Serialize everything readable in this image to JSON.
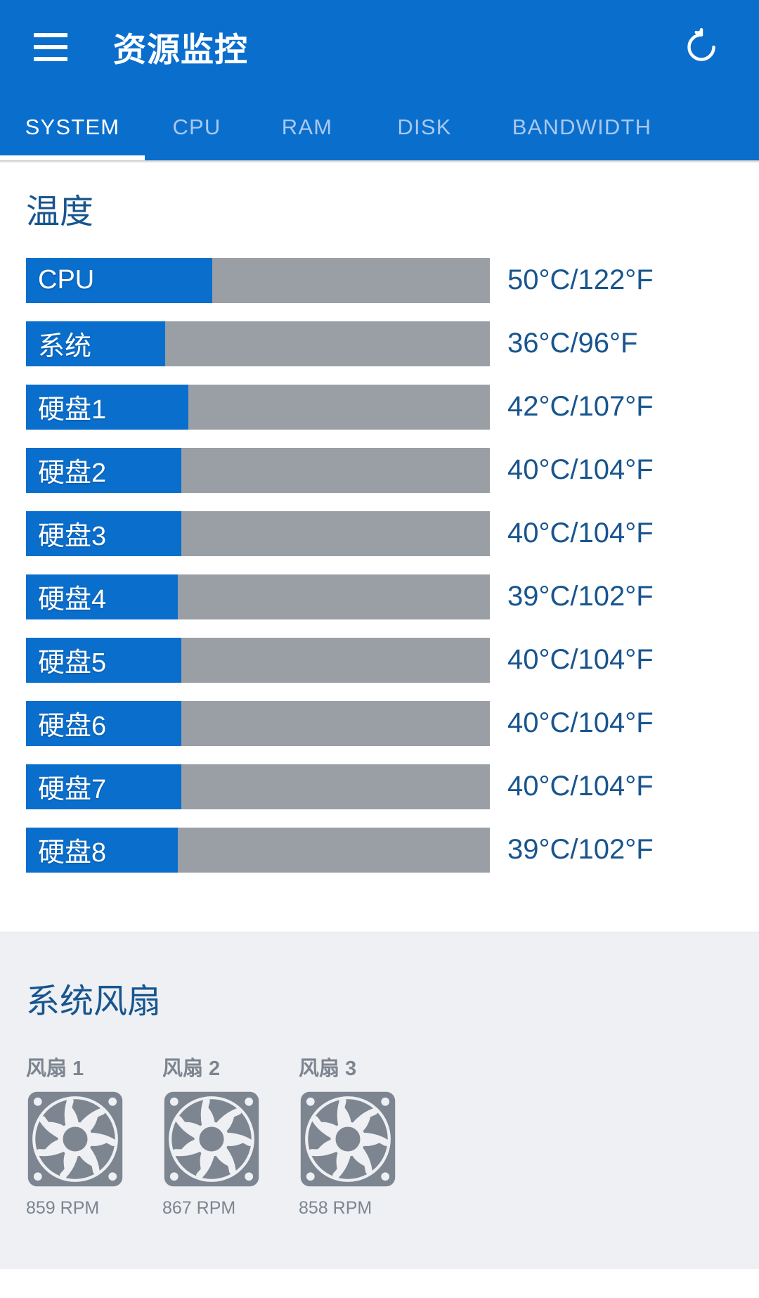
{
  "appbar": {
    "menu_icon": "hamburger-menu-icon",
    "title": "资源监控",
    "refresh_icon": "refresh-icon",
    "background": "#0a6ecd"
  },
  "tabs": [
    {
      "label": "SYSTEM",
      "active": true
    },
    {
      "label": "CPU",
      "active": false
    },
    {
      "label": "RAM",
      "active": false
    },
    {
      "label": "DISK",
      "active": false
    },
    {
      "label": "BANDWIDTH",
      "active": false
    }
  ],
  "temperature": {
    "title": "温度",
    "bar_fill_color": "#0a6ecd",
    "bar_track_color": "#9a9fa6",
    "rows": [
      {
        "label": "CPU",
        "value": "50°C/122°F",
        "celsius": 50,
        "fahrenheit": 122,
        "fill_pct": 40.2
      },
      {
        "label": "系统",
        "value": "36°C/96°F",
        "celsius": 36,
        "fahrenheit": 96,
        "fill_pct": 30.0
      },
      {
        "label": "硬盘1",
        "value": "42°C/107°F",
        "celsius": 42,
        "fahrenheit": 107,
        "fill_pct": 35.0
      },
      {
        "label": "硬盘2",
        "value": "40°C/104°F",
        "celsius": 40,
        "fahrenheit": 104,
        "fill_pct": 33.5
      },
      {
        "label": "硬盘3",
        "value": "40°C/104°F",
        "celsius": 40,
        "fahrenheit": 104,
        "fill_pct": 33.5
      },
      {
        "label": "硬盘4",
        "value": "39°C/102°F",
        "celsius": 39,
        "fahrenheit": 102,
        "fill_pct": 32.7
      },
      {
        "label": "硬盘5",
        "value": "40°C/104°F",
        "celsius": 40,
        "fahrenheit": 104,
        "fill_pct": 33.5
      },
      {
        "label": "硬盘6",
        "value": "40°C/104°F",
        "celsius": 40,
        "fahrenheit": 104,
        "fill_pct": 33.5
      },
      {
        "label": "硬盘7",
        "value": "40°C/104°F",
        "celsius": 40,
        "fahrenheit": 104,
        "fill_pct": 33.5
      },
      {
        "label": "硬盘8",
        "value": "39°C/102°F",
        "celsius": 39,
        "fahrenheit": 102,
        "fill_pct": 32.7
      }
    ]
  },
  "fans": {
    "title": "系统风扇",
    "items": [
      {
        "name": "风扇 1",
        "rpm": "859 RPM",
        "rpm_value": 859
      },
      {
        "name": "风扇 2",
        "rpm": "867 RPM",
        "rpm_value": 867
      },
      {
        "name": "风扇 3",
        "rpm": "858 RPM",
        "rpm_value": 858
      }
    ],
    "icon": "fan-icon",
    "background": "#eef0f3"
  }
}
